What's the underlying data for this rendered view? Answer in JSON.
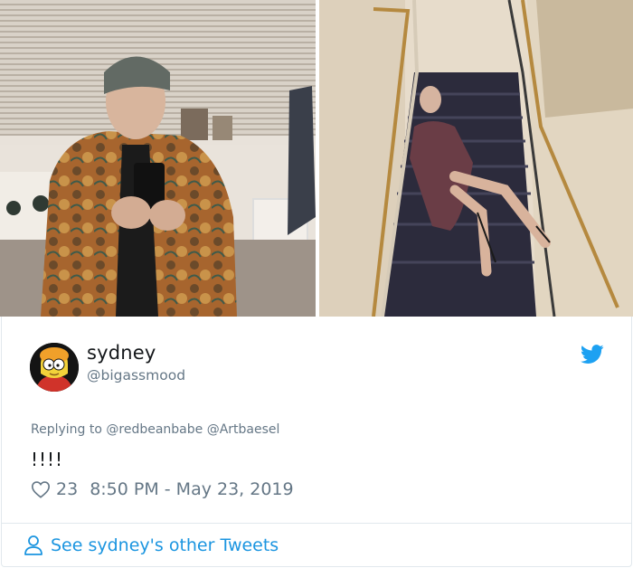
{
  "photos": {
    "left_label": "mirror selfie photo",
    "right_label": "staircase photo"
  },
  "tweet": {
    "display_name": "sydney",
    "handle": "@bigassmood",
    "replying_prefix": "Replying to",
    "replying_to": [
      "@redbeanbabe",
      "@Artbaesel"
    ],
    "text": "!!!!",
    "like_count": "23",
    "timestamp": "8:50 PM - May 23, 2019"
  },
  "footer": {
    "see_more_label": "See sydney's other Tweets"
  },
  "icons": {
    "brand": "twitter-bird-icon",
    "like": "heart-icon",
    "profile": "person-icon"
  },
  "colors": {
    "twitter_blue": "#1da1f2",
    "link_blue": "#1b95e0",
    "muted_text": "#657786",
    "primary_text": "#14171a",
    "border": "#e1e8ed"
  }
}
